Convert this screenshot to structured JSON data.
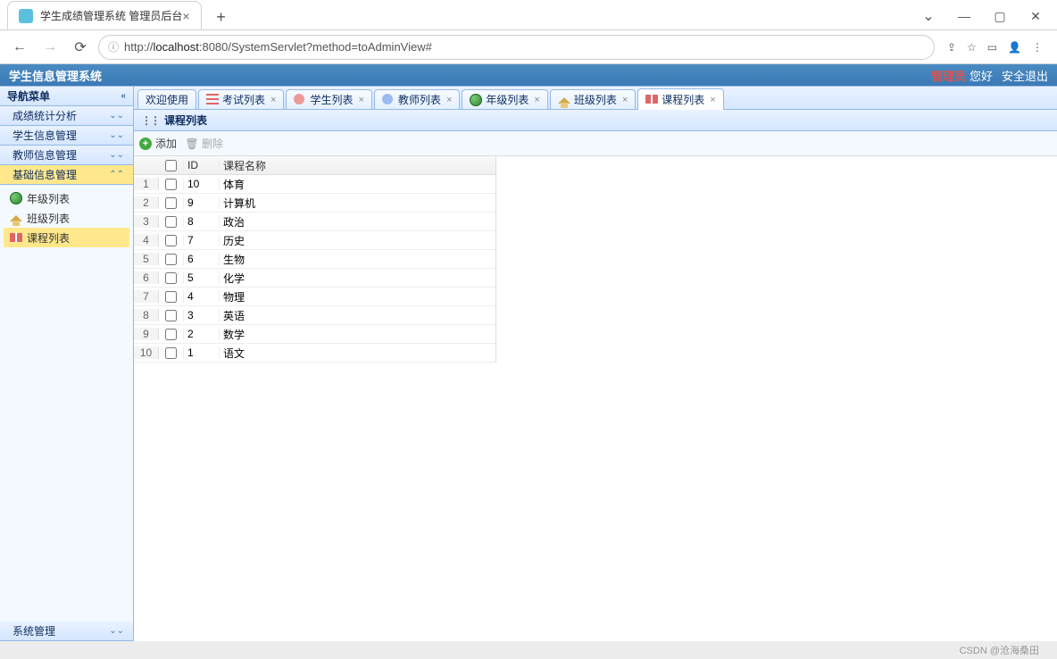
{
  "browser": {
    "tab_title": "学生成绩管理系统 管理员后台",
    "url_prefix": "http://",
    "url_host": "localhost",
    "url_path": ":8080/SystemServlet?method=toAdminView#"
  },
  "app": {
    "title": "学生信息管理系统",
    "role": "管理员",
    "greeting": "您好",
    "logout": "安全退出"
  },
  "sidebar": {
    "header": "导航菜单",
    "items": [
      {
        "label": "成绩统计分析",
        "expanded": false
      },
      {
        "label": "学生信息管理",
        "expanded": false
      },
      {
        "label": "教师信息管理",
        "expanded": false
      },
      {
        "label": "基础信息管理",
        "expanded": true
      }
    ],
    "tree": [
      {
        "label": "年级列表",
        "icon": "globe"
      },
      {
        "label": "班级列表",
        "icon": "house"
      },
      {
        "label": "课程列表",
        "icon": "book",
        "selected": true
      }
    ],
    "footer": "系统管理"
  },
  "tabs": [
    {
      "label": "欢迎使用",
      "closable": false
    },
    {
      "label": "考试列表",
      "icon": "list",
      "closable": true
    },
    {
      "label": "学生列表",
      "icon": "user",
      "closable": true
    },
    {
      "label": "教师列表",
      "icon": "teacher",
      "closable": true
    },
    {
      "label": "年级列表",
      "icon": "globe",
      "closable": true
    },
    {
      "label": "班级列表",
      "icon": "house",
      "closable": true
    },
    {
      "label": "课程列表",
      "icon": "book",
      "closable": true,
      "active": true
    }
  ],
  "panel": {
    "title": "课程列表",
    "add_label": "添加",
    "del_label": "删除"
  },
  "grid": {
    "columns": {
      "id": "ID",
      "name": "课程名称"
    },
    "rows": [
      {
        "n": "1",
        "id": "10",
        "name": "体育"
      },
      {
        "n": "2",
        "id": "9",
        "name": "计算机"
      },
      {
        "n": "3",
        "id": "8",
        "name": "政治"
      },
      {
        "n": "4",
        "id": "7",
        "name": "历史"
      },
      {
        "n": "5",
        "id": "6",
        "name": "生物"
      },
      {
        "n": "6",
        "id": "5",
        "name": "化学"
      },
      {
        "n": "7",
        "id": "4",
        "name": "物理"
      },
      {
        "n": "8",
        "id": "3",
        "name": "英语"
      },
      {
        "n": "9",
        "id": "2",
        "name": "数学"
      },
      {
        "n": "10",
        "id": "1",
        "name": "语文"
      }
    ]
  },
  "watermark": "CSDN @沧海桑田"
}
